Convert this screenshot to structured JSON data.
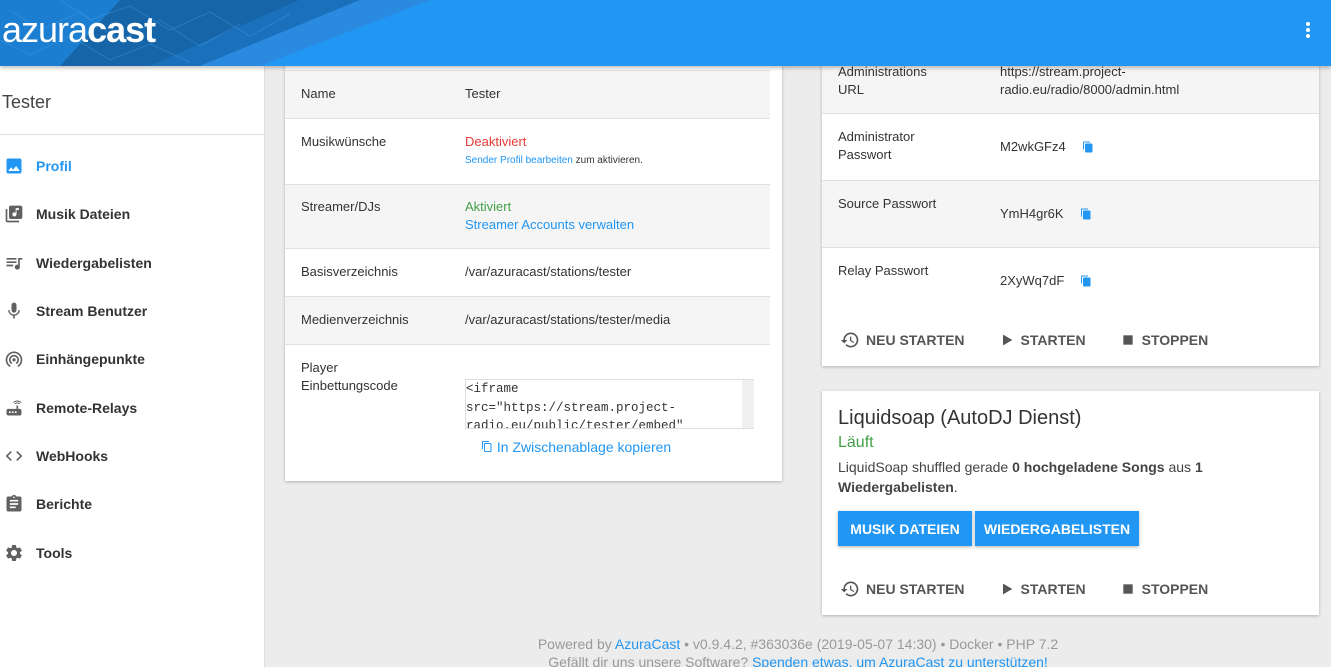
{
  "app": {
    "logo_light": "azura",
    "logo_bold": "cast"
  },
  "sidebar": {
    "station_name": "Tester",
    "items": [
      {
        "label": "Profil",
        "icon": "image-icon",
        "active": true
      },
      {
        "label": "Musik Dateien",
        "icon": "music-library-icon"
      },
      {
        "label": "Wiedergabelisten",
        "icon": "queue-music-icon"
      },
      {
        "label": "Stream Benutzer",
        "icon": "microphone-icon"
      },
      {
        "label": "Einhängepunkte",
        "icon": "wifi-tethering-icon"
      },
      {
        "label": "Remote-Relays",
        "icon": "router-icon"
      },
      {
        "label": "WebHooks",
        "icon": "code-icon"
      },
      {
        "label": "Berichte",
        "icon": "assignment-icon"
      },
      {
        "label": "Tools",
        "icon": "settings-icon"
      }
    ]
  },
  "profile_table": {
    "name_label": "Name",
    "name_value": "Tester",
    "requests_label": "Musikwünsche",
    "requests_status": "Deaktiviert",
    "requests_link": "Sender Profil bearbeiten",
    "requests_suffix": " zum aktivieren.",
    "streamers_label": "Streamer/DJs",
    "streamers_status": "Aktiviert",
    "streamers_link": "Streamer Accounts verwalten",
    "base_dir_label": "Basisverzeichnis",
    "base_dir_value": "/var/azuracast/stations/tester",
    "media_dir_label": "Medienverzeichnis",
    "media_dir_value": "/var/azuracast/stations/tester/media",
    "embed_label_1": "Player",
    "embed_label_2": "Einbettungscode",
    "embed_line_1": "<iframe",
    "embed_line_2": "src=\"https://stream.project-",
    "embed_line_3": "radio.eu/public/tester/embed\"",
    "copy_label": "In Zwischenablage kopieren"
  },
  "server_card": {
    "admin_url_label_1": "Administrations",
    "admin_url_label_2": "URL",
    "admin_url_line_1": "https://stream.project-",
    "admin_url_line_2": "radio.eu/radio/8000/admin.html",
    "admin_pw_label_1": "Administrator",
    "admin_pw_label_2": "Passwort",
    "admin_pw_value": "M2wkGFz4",
    "source_pw_label": "Source Passwort",
    "source_pw_value": "YmH4gr6K",
    "relay_pw_label": "Relay Passwort",
    "relay_pw_value": "2XyWq7dF",
    "restart": "NEU STARTEN",
    "start": "STARTEN",
    "stop": "STOPPEN"
  },
  "liquidsoap": {
    "title": "Liquidsoap (AutoDJ Dienst)",
    "status": "Läuft",
    "desc_1": "LiquidSoap shuffled gerade ",
    "desc_bold_1": "0 hochgeladene Songs",
    "desc_2": " aus ",
    "desc_bold_2": "1",
    "desc_bold_3": "Wiedergabelisten",
    "desc_3": ".",
    "btn_music": "MUSIK DATEIEN",
    "btn_playlists": "WIEDERGABELISTEN",
    "restart": "NEU STARTEN",
    "start": "STARTEN",
    "stop": "STOPPEN"
  },
  "footer": {
    "powered_by": "Powered by ",
    "azuracast_link": "AzuraCast",
    "version": " • v0.9.4.2, #363036e (2019-05-07 14:30) • Docker • PHP 7.2",
    "like_text": "Gefällt dir uns unsere Software? ",
    "donate_link": "Spenden etwas, um AzuraCast zu unterstützen!"
  },
  "colors": {
    "accent": "#2196f3",
    "danger": "#e53935",
    "success": "#43a047"
  }
}
